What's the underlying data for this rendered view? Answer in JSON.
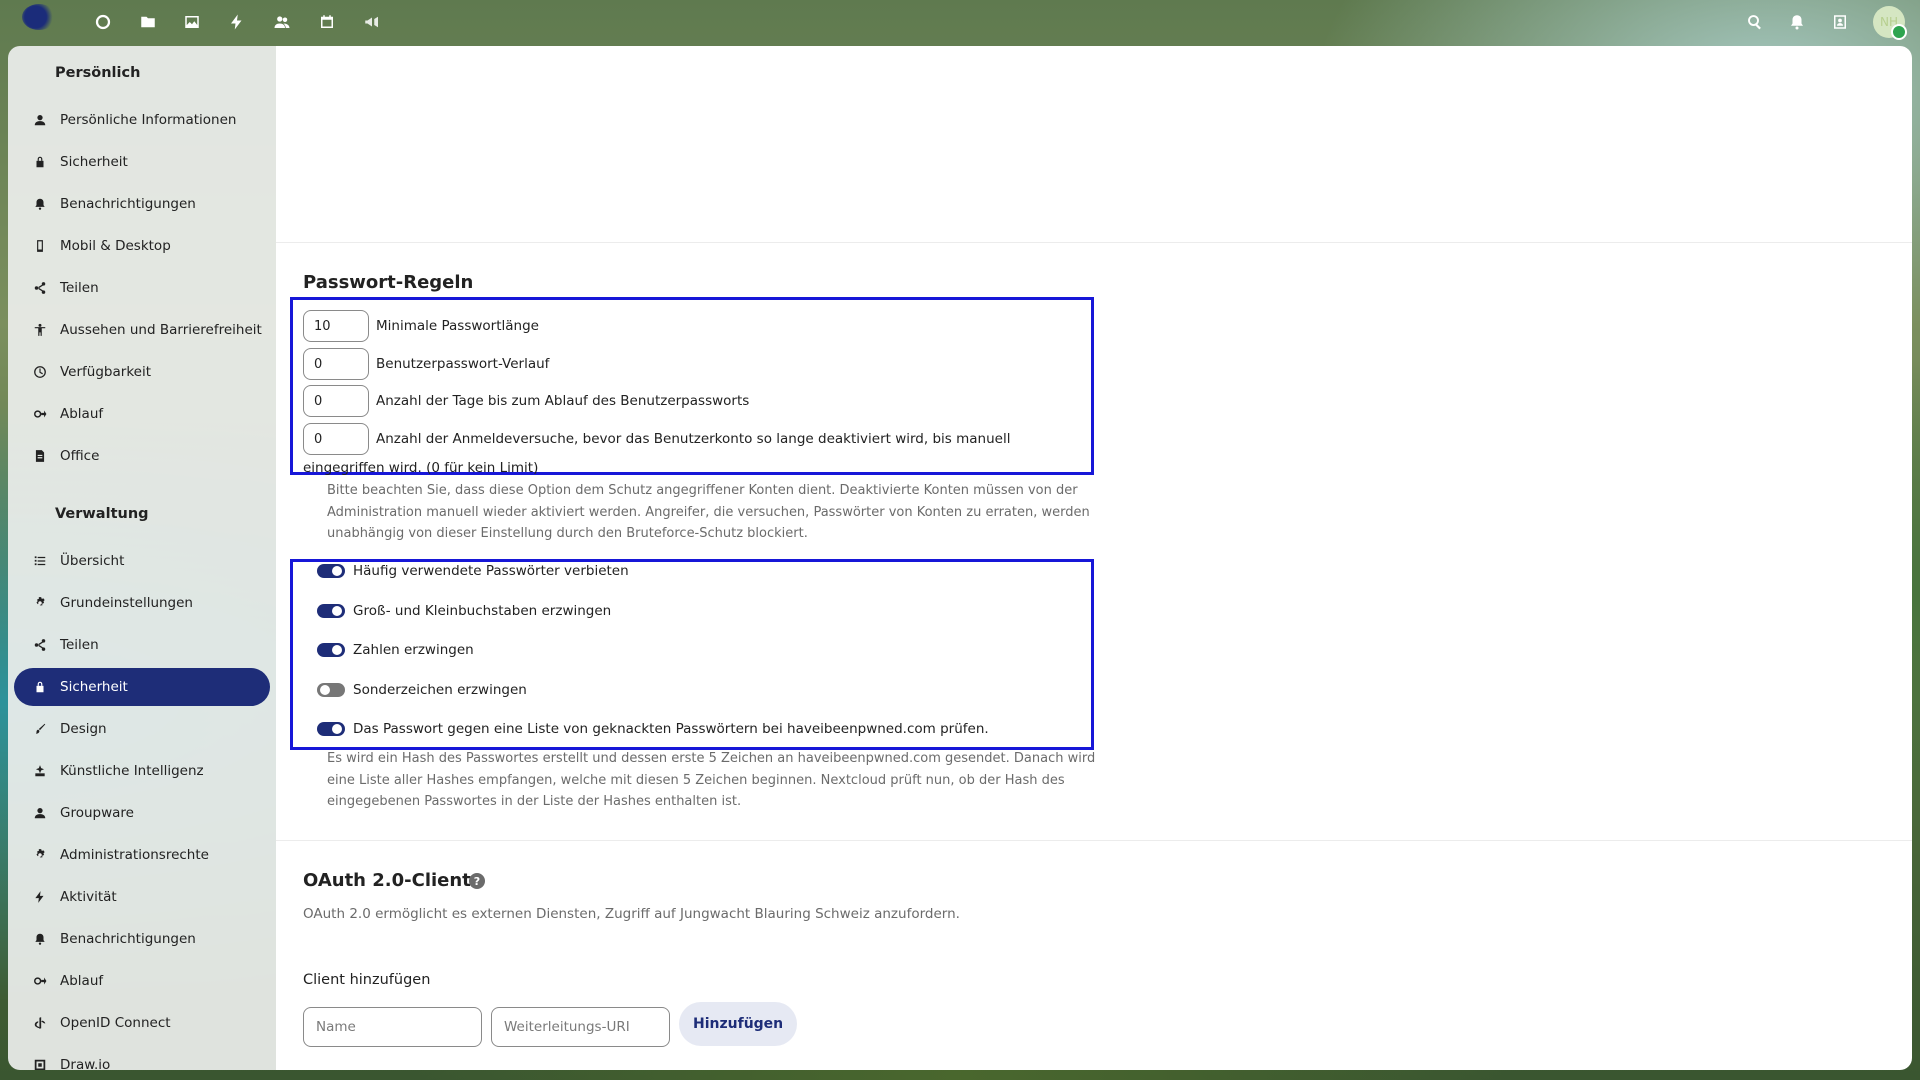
{
  "header": {
    "apps": [
      {
        "icon": "dashboard-icon"
      },
      {
        "icon": "files-icon"
      },
      {
        "icon": "photos-icon"
      },
      {
        "icon": "activity-icon"
      },
      {
        "icon": "contacts-icon"
      },
      {
        "icon": "calendar-icon"
      },
      {
        "icon": "announcements-icon"
      }
    ],
    "right_icons": [
      "search-icon",
      "notifications-icon",
      "contacts-menu-icon"
    ],
    "avatar_initials": "NH"
  },
  "sidebar": {
    "personal_title": "Persönlich",
    "personal_items": [
      {
        "label": "Persönliche Informationen",
        "icon": "user-icon"
      },
      {
        "label": "Sicherheit",
        "icon": "lock-icon"
      },
      {
        "label": "Benachrichtigungen",
        "icon": "bell-icon"
      },
      {
        "label": "Mobil & Desktop",
        "icon": "phone-icon"
      },
      {
        "label": "Teilen",
        "icon": "share-icon"
      },
      {
        "label": "Aussehen und Barrierefreiheit",
        "icon": "accessibility-icon"
      },
      {
        "label": "Verfügbarkeit",
        "icon": "clock-icon"
      },
      {
        "label": "Ablauf",
        "icon": "flow-icon"
      },
      {
        "label": "Office",
        "icon": "document-icon"
      }
    ],
    "admin_title": "Verwaltung",
    "admin_items": [
      {
        "label": "Übersicht",
        "icon": "list-icon"
      },
      {
        "label": "Grundeinstellungen",
        "icon": "gear-icon"
      },
      {
        "label": "Teilen",
        "icon": "share-icon"
      },
      {
        "label": "Sicherheit",
        "icon": "lock-icon",
        "active": true
      },
      {
        "label": "Design",
        "icon": "brush-icon"
      },
      {
        "label": "Künstliche Intelligenz",
        "icon": "ai-icon"
      },
      {
        "label": "Groupware",
        "icon": "groupware-icon"
      },
      {
        "label": "Administrationsrechte",
        "icon": "admin-gear-icon"
      },
      {
        "label": "Aktivität",
        "icon": "activity-icon"
      },
      {
        "label": "Benachrichtigungen",
        "icon": "bell-icon"
      },
      {
        "label": "Ablauf",
        "icon": "flow-icon"
      },
      {
        "label": "OpenID Connect",
        "icon": "openid-icon"
      },
      {
        "label": "Draw.io",
        "icon": "drawio-icon"
      }
    ]
  },
  "password_rules": {
    "title": "Passwort-Regeln",
    "min_length_value": "10",
    "min_length_label": "Minimale Passwortlänge",
    "history_value": "0",
    "history_label": "Benutzerpasswort-Verlauf",
    "expiry_value": "0",
    "expiry_label": "Anzahl der Tage bis zum Ablauf des Benutzerpassworts",
    "attempts_value": "0",
    "attempts_label": "Anzahl der Anmeldeversuche, bevor das Benutzerkonto so lange deaktiviert wird, bis manuell eingegriffen wird. (0 für kein Limit)",
    "attempts_hint": "Bitte beachten Sie, dass diese Option dem Schutz angegriffener Konten dient. Deaktivierte Konten müssen von der Administration manuell wieder aktiviert werden. Angreifer, die versuchen, Passwörter von Konten zu erraten, werden unabhängig von dieser Einstellung durch den Bruteforce-Schutz blockiert.",
    "toggles": [
      {
        "label": "Häufig verwendete Passwörter verbieten",
        "on": true
      },
      {
        "label": "Groß- und Kleinbuchstaben erzwingen",
        "on": true
      },
      {
        "label": "Zahlen erzwingen",
        "on": true
      },
      {
        "label": "Sonderzeichen erzwingen",
        "on": false
      },
      {
        "label": "Das Passwort gegen eine Liste von geknackten Passwörtern bei haveibeenpwned.com prüfen.",
        "on": true
      }
    ],
    "hibp_hint": "Es wird ein Hash des Passwortes erstellt und dessen erste 5 Zeichen an haveibeenpwned.com gesendet. Danach wird eine Liste aller Hashes empfangen, welche mit diesen 5 Zeichen beginnen. Nextcloud prüft nun, ob der Hash des eingegebenen Passwortes in der Liste der Hashes enthalten ist."
  },
  "oauth": {
    "title": "OAuth 2.0-Clients",
    "description": "OAuth 2.0 ermöglicht es externen Diensten, Zugriff auf Jungwacht Blauring Schweiz anzufordern.",
    "add_client_title": "Client hinzufügen",
    "name_placeholder": "Name",
    "uri_placeholder": "Weiterleitungs-URI",
    "add_button": "Hinzufügen"
  },
  "colors": {
    "accent": "#1e2d78",
    "highlight_box": "#1717d8"
  }
}
